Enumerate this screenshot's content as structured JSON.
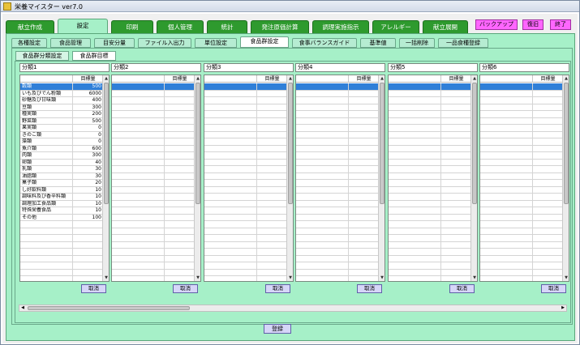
{
  "window": {
    "title": "栄養マイスター ver7.0"
  },
  "main_tabs": [
    {
      "label": "献立作成"
    },
    {
      "label": "設定"
    },
    {
      "label": "印刷"
    },
    {
      "label": "個人管理"
    },
    {
      "label": "統計"
    },
    {
      "label": "発注原価計算"
    },
    {
      "label": "調理実施指示"
    },
    {
      "label": "アレルギー"
    },
    {
      "label": "献立展開"
    }
  ],
  "top_buttons": {
    "backup": "バックアップ",
    "restore": "復旧",
    "exit": "終了"
  },
  "sub_tabs": [
    {
      "label": "各種設定"
    },
    {
      "label": "食品管理"
    },
    {
      "label": "目安分量"
    },
    {
      "label": "ファイル入出力"
    },
    {
      "label": "単位設定"
    },
    {
      "label": "食品群設定"
    },
    {
      "label": "食事バランスガイド"
    },
    {
      "label": "基準値"
    },
    {
      "label": "一括削除"
    },
    {
      "label": "一品食種登録"
    }
  ],
  "inner_tabs": [
    {
      "label": "食品群分類設定"
    },
    {
      "label": "食品群目標"
    }
  ],
  "groups": [
    {
      "label": "分類1",
      "col_header": "目標量",
      "cancel": "取消",
      "rows": [
        {
          "name": "穀類",
          "value": "500"
        },
        {
          "name": "いも及びでん粉類",
          "value": "6000"
        },
        {
          "name": "砂糖及び甘味類",
          "value": "400"
        },
        {
          "name": "豆類",
          "value": "300"
        },
        {
          "name": "種実類",
          "value": "200"
        },
        {
          "name": "野菜類",
          "value": "500"
        },
        {
          "name": "果実類",
          "value": "0"
        },
        {
          "name": "きのこ類",
          "value": "0"
        },
        {
          "name": "藻類",
          "value": "0"
        },
        {
          "name": "魚介類",
          "value": "600"
        },
        {
          "name": "肉類",
          "value": "300"
        },
        {
          "name": "卵類",
          "value": "40"
        },
        {
          "name": "乳類",
          "value": "30"
        },
        {
          "name": "油脂類",
          "value": "30"
        },
        {
          "name": "菓子類",
          "value": "20"
        },
        {
          "name": "し好飲料類",
          "value": "10"
        },
        {
          "name": "調味料及び香辛料類",
          "value": "10"
        },
        {
          "name": "調理加工食品類",
          "value": "10"
        },
        {
          "name": "特殊栄養食品",
          "value": "10"
        },
        {
          "name": "その他",
          "value": "100"
        }
      ]
    },
    {
      "label": "分類2",
      "col_header": "目標量",
      "cancel": "取消",
      "rows": []
    },
    {
      "label": "分類3",
      "col_header": "目標量",
      "cancel": "取消",
      "rows": []
    },
    {
      "label": "分類4",
      "col_header": "目標量",
      "cancel": "取消",
      "rows": []
    },
    {
      "label": "分類5",
      "col_header": "目標量",
      "cancel": "取消",
      "rows": []
    },
    {
      "label": "分類6",
      "col_header": "目標量",
      "cancel": "取消",
      "rows": []
    }
  ],
  "register_button": "登録",
  "colors": {
    "accent_green": "#2e9a2e",
    "panel": "#a6f0c8",
    "pink_button": "#ff66ff",
    "selection": "#2f7fd8"
  }
}
